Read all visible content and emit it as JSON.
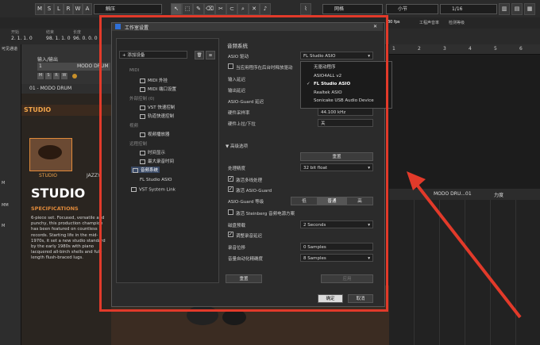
{
  "toolbar": {
    "mode_buttons": [
      "M",
      "S",
      "L",
      "R",
      "W",
      "A"
    ],
    "touch_mode": "触压",
    "snap_type": "网格",
    "quantize": "小节",
    "quantize_value": "1/16"
  },
  "row2": {
    "cells": [
      "",
      "",
      "",
      "",
      "",
      "",
      "",
      "",
      "",
      "",
      "",
      "",
      "",
      ""
    ],
    "fps": "30 fps",
    "setup": "工程声音率",
    "meter": "检测等级"
  },
  "row3": {
    "left_top": "开始",
    "left_val": "2. 1. 1. 0",
    "mid_top": "结束",
    "mid_val": "98. 1. 1. 0",
    "length_top": "长度",
    "length_val": "96. 0. 0. 0"
  },
  "left_panel": {
    "title": "可见通道",
    "items": [
      "M",
      "MM",
      "M"
    ]
  },
  "tracklist": {
    "header": "输入/输出",
    "track_name": "MODO DRUM",
    "track_number": "1"
  },
  "plugin": {
    "instance": "01 - MODO DRUM",
    "brand": "STUDIO",
    "kits": [
      "STUDIO",
      "JAZZY"
    ],
    "heading": "STUDIO",
    "sub": "SPECIFICATIONS",
    "description": "6-piece set. Focused, versatile and punchy, this production champion has been featured on countless records. Starting life in the mid-1970s, it set a new studio standard by the early 1980s with piano lacquered all-birch shells and full-length flush-braced lugs."
  },
  "right_area": {
    "ruler": [
      "1",
      "2",
      "3",
      "4",
      "5",
      "6"
    ],
    "track": "MODO DRU...01",
    "param": "力度"
  },
  "dialog": {
    "title": "工作室设置",
    "devices_label": "设备",
    "add_device": "添加设备",
    "tree": [
      {
        "label": "MIDI",
        "type": "group"
      },
      {
        "label": "MIDI 外挂",
        "type": "item"
      },
      {
        "label": "MIDI 端口设置",
        "type": "item"
      },
      {
        "label": "外部控制 (0)",
        "type": "group"
      },
      {
        "label": "VST 快速控制",
        "type": "item"
      },
      {
        "label": "轨道快速控制",
        "type": "item"
      },
      {
        "label": "视频",
        "type": "group"
      },
      {
        "label": "视频播放器",
        "type": "item"
      },
      {
        "label": "远程控制",
        "type": "group"
      },
      {
        "label": "时间显示",
        "type": "item"
      },
      {
        "label": "最大录音时间",
        "type": "item"
      },
      {
        "label": "音频系统",
        "type": "selected"
      },
      {
        "label": "FL Studio ASIO",
        "type": "item"
      },
      {
        "label": "VST System Link",
        "type": "item"
      }
    ],
    "section": "音频系统",
    "asio_driver_label": "ASIO 驱动",
    "asio_driver_value": "FL Studio ASIO",
    "release_driver": "当应用程序在后台时释放驱动",
    "input_latency": "输入延迟",
    "output_latency": "输出延迟",
    "asio_guard_latency": "ASIO-Guard 延迟",
    "hw_sample_rate": "硬件采样率",
    "hw_sample_rate_value": "44.100 kHz",
    "hw_pullup": "硬件上拉/下拉",
    "hw_pullup_value": "关",
    "advanced": "高级选项",
    "reset": "重置",
    "precision_label": "处理精度",
    "precision_value": "32 bit float",
    "multi_processing": "激活多线处理",
    "asio_guard": "激活 ASIO-Guard",
    "asio_guard_level": "ASIO-Guard 等级",
    "levels": [
      "低",
      "普通",
      "高"
    ],
    "steinberg_power": "激活 Steinberg 音频电源方案",
    "disk_preload": "磁盘预载",
    "disk_preload_value": "2 Seconds",
    "adjust_latency": "调整录音延迟",
    "record_offset": "录音位移",
    "record_offset_value": "0 Samples",
    "volume_auto": "音量自动化精确度",
    "volume_auto_value": "8 Samples",
    "reset_bottom": "重置",
    "apply": "应用",
    "ok": "确定",
    "cancel": "取消"
  },
  "driver_dropdown": {
    "options": [
      "无驱动程序",
      "ASIO4ALL v2",
      "FL Studio ASIO",
      "Realtek ASIO",
      "Sonicake USB Audio Device"
    ],
    "selected": "FL Studio ASIO"
  },
  "colors": {
    "highlight": "#e23a2a",
    "accent_blue": "#2f6fd6"
  }
}
